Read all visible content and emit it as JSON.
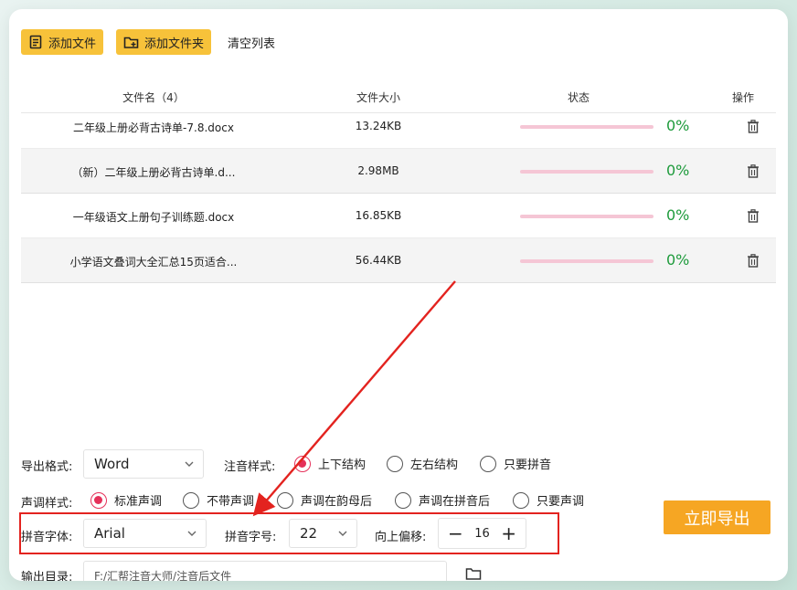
{
  "toolbar": {
    "add_file": "添加文件",
    "add_folder": "添加文件夹",
    "clear_list": "清空列表"
  },
  "table": {
    "headers": {
      "name": "文件名（4）",
      "size": "文件大小",
      "status": "状态",
      "action": "操作"
    },
    "rows": [
      {
        "name": "二年级上册必背古诗单-7.8.docx",
        "size": "13.24KB",
        "progress": 0,
        "percent": "0%"
      },
      {
        "name": "（新）二年级上册必背古诗单.d...",
        "size": "2.98MB",
        "progress": 0,
        "percent": "0%"
      },
      {
        "name": "一年级语文上册句子训练题.docx",
        "size": "16.85KB",
        "progress": 0,
        "percent": "0%"
      },
      {
        "name": "小学语文叠词大全汇总15页适合...",
        "size": "56.44KB",
        "progress": 0,
        "percent": "0%"
      }
    ]
  },
  "options": {
    "export_format_label": "导出格式:",
    "export_format_value": "Word",
    "annotation_label": "注音样式:",
    "annotation_options": [
      "上下结构",
      "左右结构",
      "只要拼音"
    ],
    "tone_label": "声调样式:",
    "tone_options": [
      "标准声调",
      "不带声调",
      "声调在韵母后",
      "声调在拼音后",
      "只要声调"
    ],
    "font_label": "拼音字体:",
    "font_value": "Arial",
    "size_label": "拼音字号:",
    "size_value": "22",
    "offset_label": "向上偏移:",
    "offset_value": "16",
    "minus": "−",
    "plus": "+",
    "output_label": "输出目录:",
    "output_value": "F:/汇帮注音大师/注音后文件"
  },
  "export_button": "立即导出",
  "colors": {
    "accent_yellow": "#f7c23a",
    "export_orange": "#f6a623",
    "progress_pink": "#f5c6d5",
    "percent_green": "#1e9b3c",
    "radio_selected": "#e5315a",
    "annotation_red": "#e3231f"
  }
}
